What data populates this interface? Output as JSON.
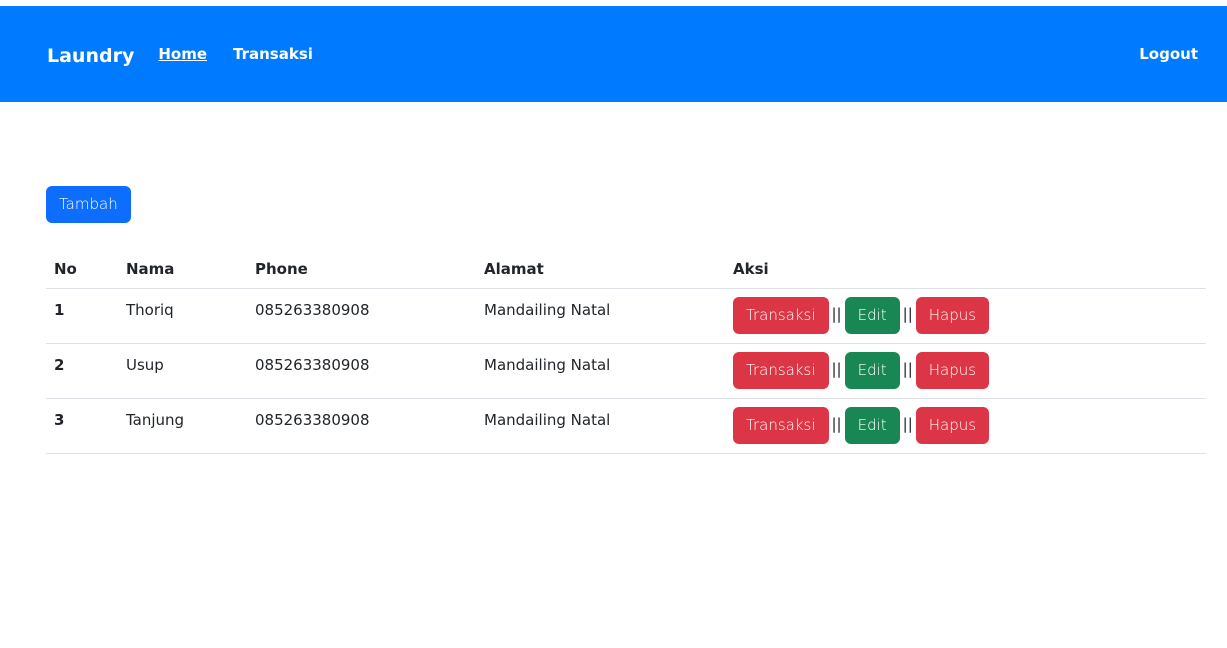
{
  "navbar": {
    "brand": "Laundry",
    "links": [
      {
        "label": "Home",
        "active": true
      },
      {
        "label": "Transaksi",
        "active": false
      }
    ],
    "logout_label": "Logout",
    "color": "#007bff"
  },
  "main": {
    "add_button_label": "Tambah",
    "table": {
      "headers": [
        "No",
        "Nama",
        "Phone",
        "Alamat",
        "Aksi"
      ],
      "rows": [
        {
          "no": "1",
          "nama": "Thoriq",
          "phone": "085263380908",
          "alamat": "Mandailing Natal"
        },
        {
          "no": "2",
          "nama": "Usup",
          "phone": "085263380908",
          "alamat": "Mandailing Natal"
        },
        {
          "no": "3",
          "nama": "Tanjung",
          "phone": "085263380908",
          "alamat": "Mandailing Natal"
        }
      ],
      "actions": {
        "transaksi_label": "Transaksi",
        "edit_label": "Edit",
        "hapus_label": "Hapus",
        "separator": "||"
      }
    }
  },
  "colors": {
    "primary": "#0d6efd",
    "danger": "#dc3545",
    "success": "#198754"
  }
}
